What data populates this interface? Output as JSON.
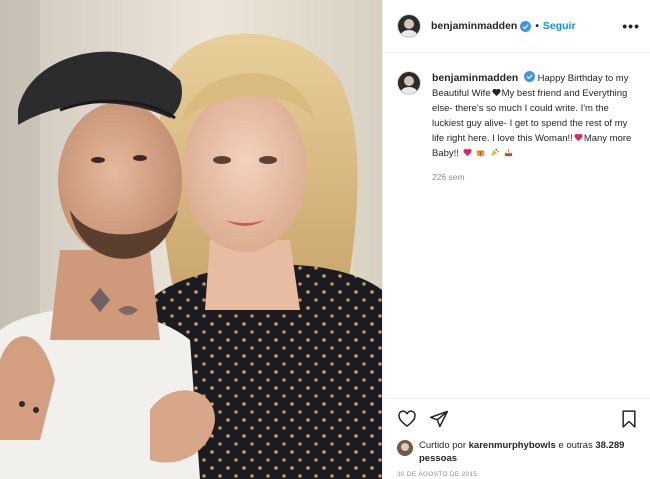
{
  "header": {
    "username": "benjaminmadden",
    "separator": "•",
    "follow_label": "Seguir",
    "more_label": "•••"
  },
  "caption": {
    "username": "benjaminmadden",
    "part1": "Happy Birthday to my Beautiful Wife",
    "part2": "My best friend and Everything else- there's so much I could write. I'm the luckiest guy alive- I get to spend the rest of my life right here. I love this Woman!!",
    "part3": "Many more Baby!!",
    "time_ago": "226 sem"
  },
  "likes": {
    "prefix": "Curtido por",
    "liker": "karenmurphybowls",
    "middle": "e outras",
    "count": "38.289",
    "suffix": "pessoas"
  },
  "date": "30 DE AGOSTO DE 2015",
  "icons": {
    "verified": "verified-badge-icon",
    "like": "heart-outline-icon",
    "share": "paper-plane-icon",
    "save": "bookmark-icon"
  },
  "colors": {
    "link_blue": "#0095f6",
    "verified_blue": "#3897f0",
    "meta_grey": "#8e8e8e"
  }
}
